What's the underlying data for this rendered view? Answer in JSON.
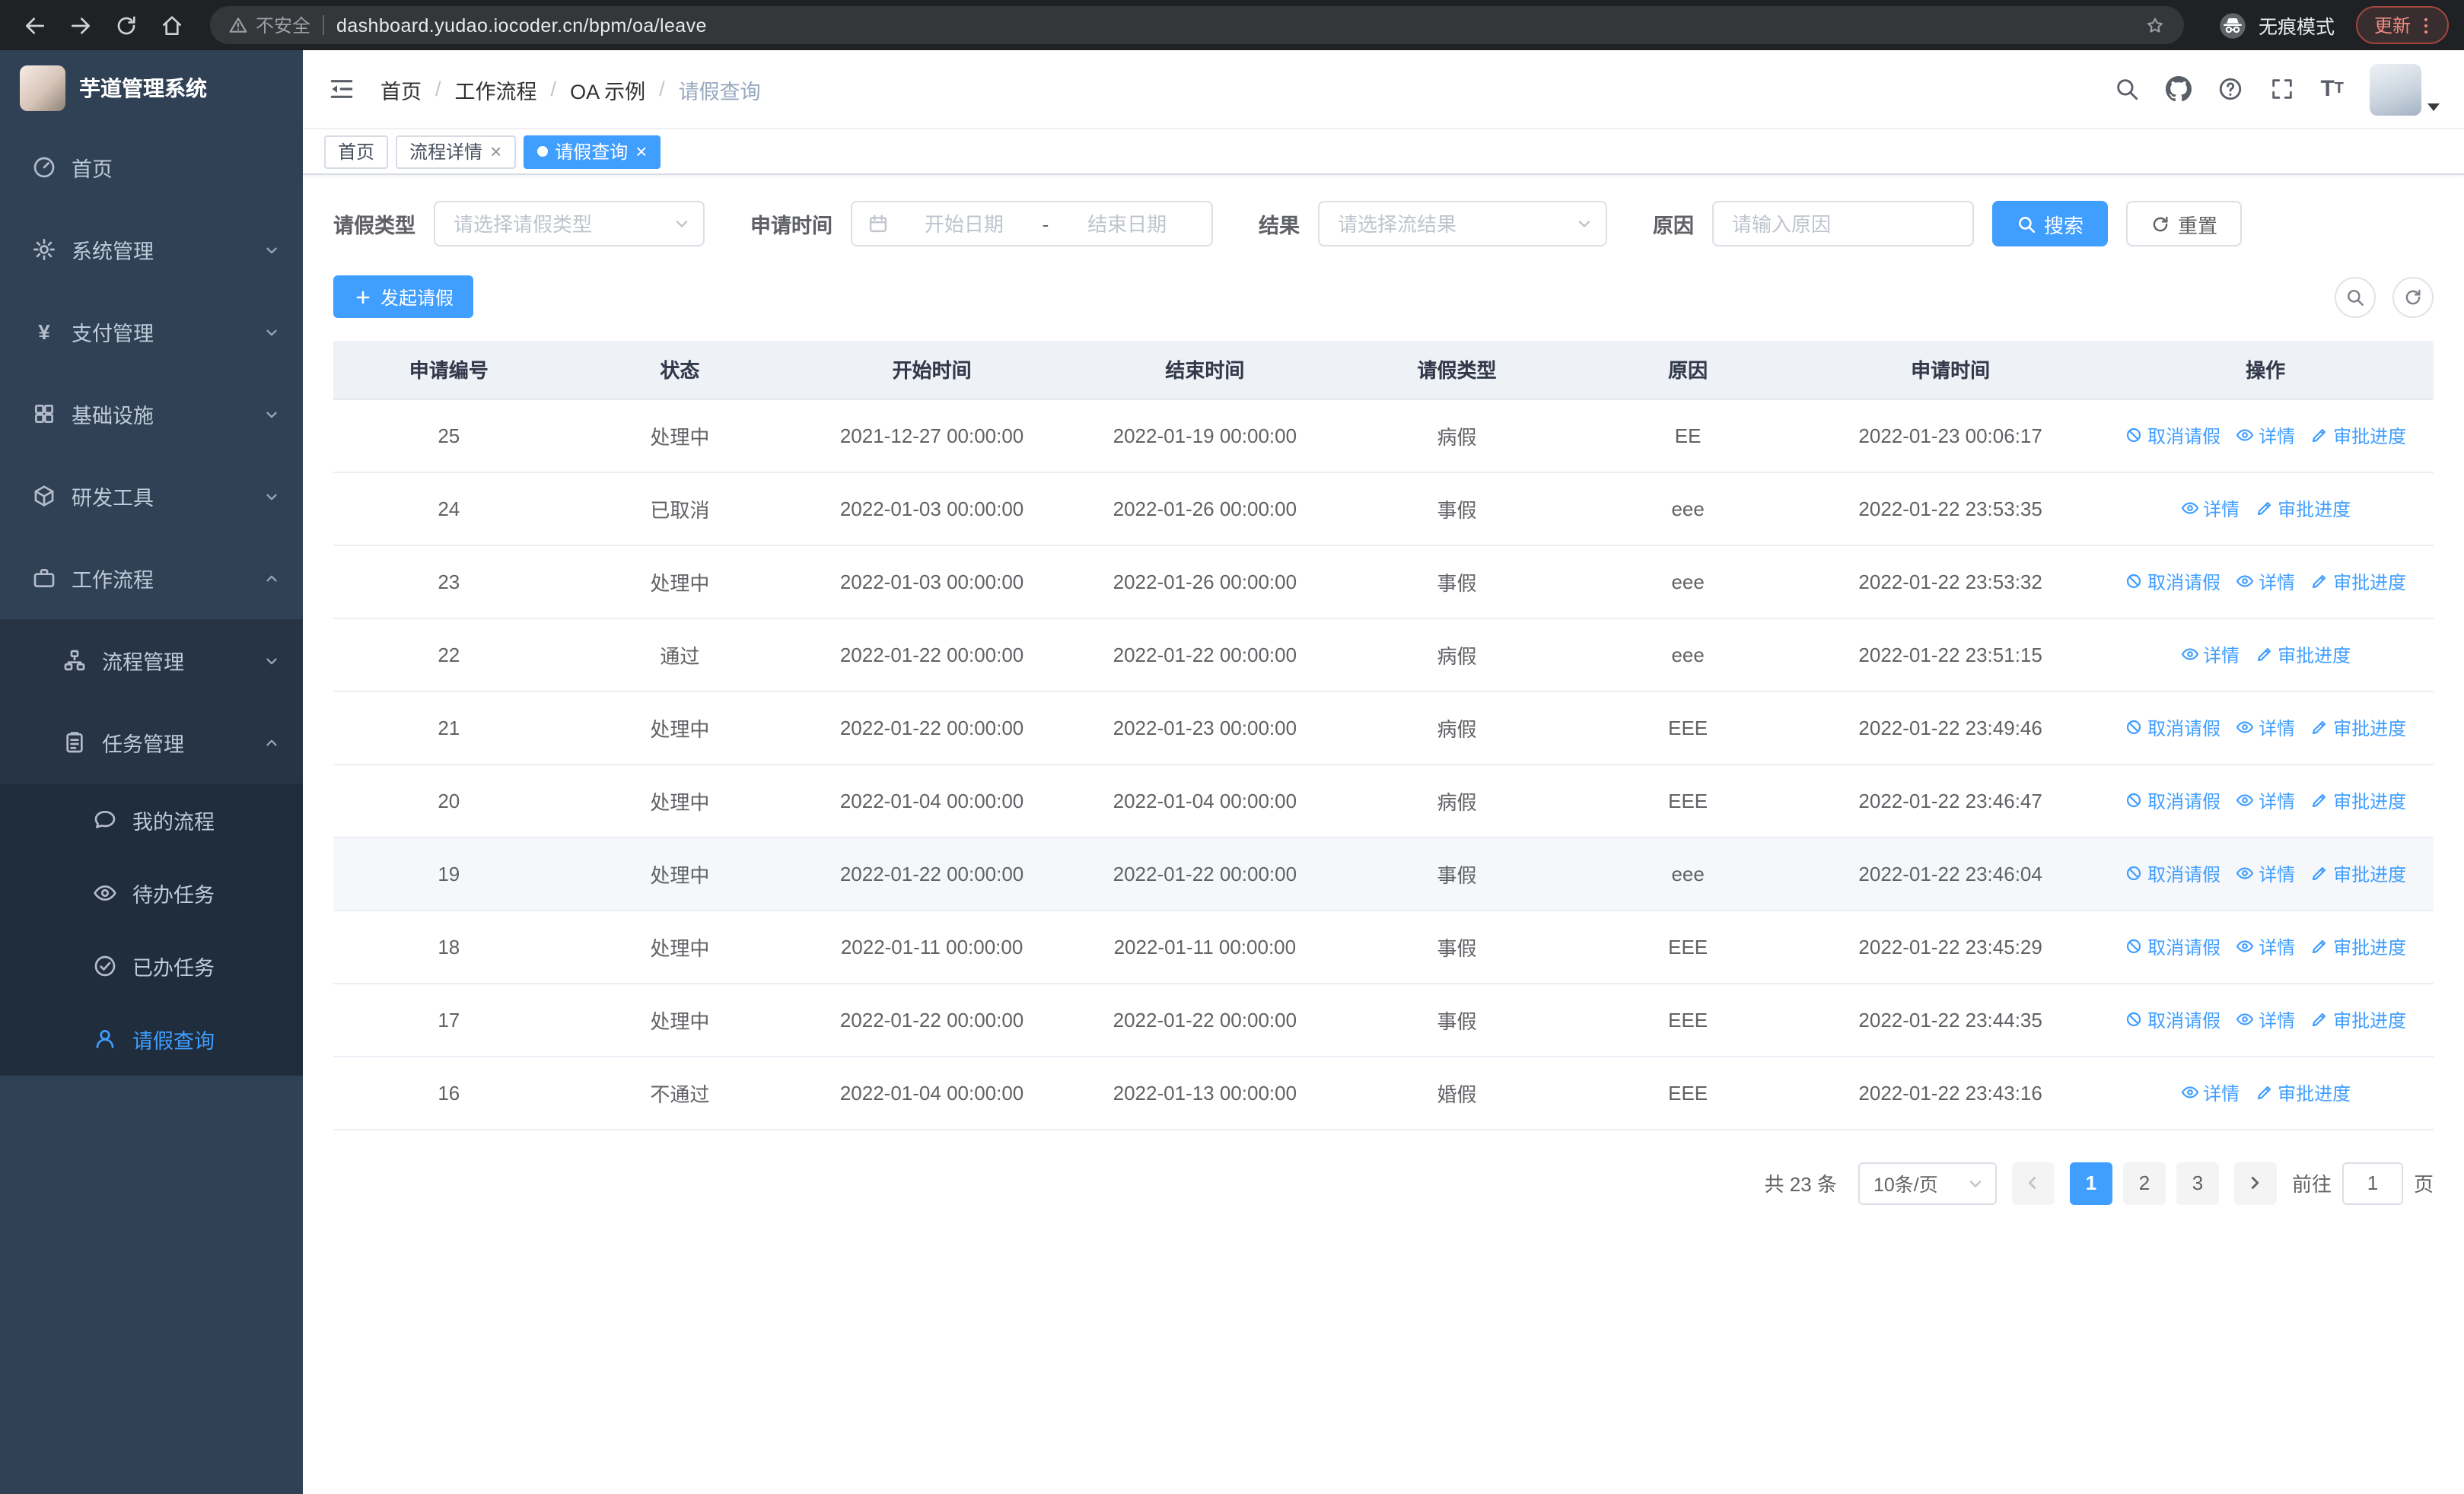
{
  "colors": {
    "accent": "#409eff",
    "sidebar_bg": "#304156",
    "sidebar_submenu_bg": "#1f2d3d",
    "update_chip": "#f28b82",
    "table_header_bg": "#eef1f6"
  },
  "icons": {
    "back-icon": "arrow-left",
    "forward-icon": "arrow-right",
    "reload-icon": "circular-arrow",
    "home-icon": "house",
    "warning-icon": "triangle-exclamation",
    "bookmark-star-icon": "star-outline",
    "incognito-icon": "spy-hat-glasses",
    "browser-menu-icon": "three-dots-vertical",
    "dashboard-icon": "gauge",
    "gear-icon": "gear",
    "yen-icon": "¥",
    "grid-icon": "four-squares",
    "box-icon": "cube",
    "briefcase-icon": "briefcase",
    "tree-icon": "org-tree",
    "clipboard-icon": "clipboard-list",
    "chat-icon": "speech-bubble",
    "eye-icon": "eye",
    "check-circle-icon": "check-in-circle",
    "user-icon": "person",
    "chevron-down-icon": "chevron-down",
    "chevron-up-icon": "chevron-up",
    "fold-icon": "indent-collapse",
    "search-icon": "magnifier",
    "github-icon": "octocat",
    "help-icon": "question-circle",
    "fullscreen-icon": "expand-corners",
    "font-size-icon": "TT",
    "calendar-icon": "calendar",
    "plus-icon": "plus",
    "refresh-icon": "circular-arrows",
    "ban-icon": "circle-slash",
    "pen-icon": "pencil"
  },
  "browser": {
    "security_warning": "不安全",
    "url": "dashboard.yudao.iocoder.cn/bpm/oa/leave",
    "incognito_label": "无痕模式",
    "update_label": "更新"
  },
  "sidebar": {
    "logo_title": "芋道管理系统",
    "menu": {
      "home": "首页",
      "system": "系统管理",
      "payment": "支付管理",
      "infra": "基础设施",
      "devtools": "研发工具",
      "workflow": "工作流程",
      "process_mgmt": "流程管理",
      "task_mgmt": "任务管理",
      "my_process": "我的流程",
      "todo_tasks": "待办任务",
      "done_tasks": "已办任务",
      "leave_query": "请假查询"
    }
  },
  "header": {
    "breadcrumb": [
      "首页",
      "工作流程",
      "OA 示例",
      "请假查询"
    ]
  },
  "tabs": [
    {
      "label": "首页"
    },
    {
      "label": "流程详情"
    },
    {
      "label": "请假查询"
    }
  ],
  "filters": {
    "leave_type_label": "请假类型",
    "leave_type_placeholder": "请选择请假类型",
    "apply_time_label": "申请时间",
    "start_date_placeholder": "开始日期",
    "range_separator": "-",
    "end_date_placeholder": "结束日期",
    "result_label": "结果",
    "result_placeholder": "请选择流结果",
    "reason_label": "原因",
    "reason_placeholder": "请输入原因",
    "search_button": "搜索",
    "reset_button": "重置"
  },
  "toolbar": {
    "create_button": "发起请假"
  },
  "table": {
    "columns": [
      "申请编号",
      "状态",
      "开始时间",
      "结束时间",
      "请假类型",
      "原因",
      "申请时间",
      "操作"
    ],
    "actions": {
      "cancel": "取消请假",
      "detail": "详情",
      "progress": "审批进度"
    },
    "rows": [
      {
        "id": "25",
        "status": "处理中",
        "start": "2021-12-27 00:00:00",
        "end": "2022-01-19 00:00:00",
        "type": "病假",
        "reason": "EE",
        "applied": "2022-01-23 00:06:17",
        "can_cancel": true,
        "highlight": false
      },
      {
        "id": "24",
        "status": "已取消",
        "start": "2022-01-03 00:00:00",
        "end": "2022-01-26 00:00:00",
        "type": "事假",
        "reason": "eee",
        "applied": "2022-01-22 23:53:35",
        "can_cancel": false,
        "highlight": false
      },
      {
        "id": "23",
        "status": "处理中",
        "start": "2022-01-03 00:00:00",
        "end": "2022-01-26 00:00:00",
        "type": "事假",
        "reason": "eee",
        "applied": "2022-01-22 23:53:32",
        "can_cancel": true,
        "highlight": false
      },
      {
        "id": "22",
        "status": "通过",
        "start": "2022-01-22 00:00:00",
        "end": "2022-01-22 00:00:00",
        "type": "病假",
        "reason": "eee",
        "applied": "2022-01-22 23:51:15",
        "can_cancel": false,
        "highlight": false
      },
      {
        "id": "21",
        "status": "处理中",
        "start": "2022-01-22 00:00:00",
        "end": "2022-01-23 00:00:00",
        "type": "病假",
        "reason": "EEE",
        "applied": "2022-01-22 23:49:46",
        "can_cancel": true,
        "highlight": false
      },
      {
        "id": "20",
        "status": "处理中",
        "start": "2022-01-04 00:00:00",
        "end": "2022-01-04 00:00:00",
        "type": "病假",
        "reason": "EEE",
        "applied": "2022-01-22 23:46:47",
        "can_cancel": true,
        "highlight": false
      },
      {
        "id": "19",
        "status": "处理中",
        "start": "2022-01-22 00:00:00",
        "end": "2022-01-22 00:00:00",
        "type": "事假",
        "reason": "eee",
        "applied": "2022-01-22 23:46:04",
        "can_cancel": true,
        "highlight": true
      },
      {
        "id": "18",
        "status": "处理中",
        "start": "2022-01-11 00:00:00",
        "end": "2022-01-11 00:00:00",
        "type": "事假",
        "reason": "EEE",
        "applied": "2022-01-22 23:45:29",
        "can_cancel": true,
        "highlight": false
      },
      {
        "id": "17",
        "status": "处理中",
        "start": "2022-01-22 00:00:00",
        "end": "2022-01-22 00:00:00",
        "type": "事假",
        "reason": "EEE",
        "applied": "2022-01-22 23:44:35",
        "can_cancel": true,
        "highlight": false
      },
      {
        "id": "16",
        "status": "不通过",
        "start": "2022-01-04 00:00:00",
        "end": "2022-01-13 00:00:00",
        "type": "婚假",
        "reason": "EEE",
        "applied": "2022-01-22 23:43:16",
        "can_cancel": false,
        "highlight": false
      }
    ]
  },
  "pagination": {
    "total": "共 23 条",
    "page_size": "10条/页",
    "pages": [
      {
        "label": "1",
        "active": true
      },
      {
        "label": "2",
        "active": false
      },
      {
        "label": "3",
        "active": false
      }
    ],
    "goto_label": "前往",
    "goto_value": "1",
    "goto_suffix": "页"
  }
}
